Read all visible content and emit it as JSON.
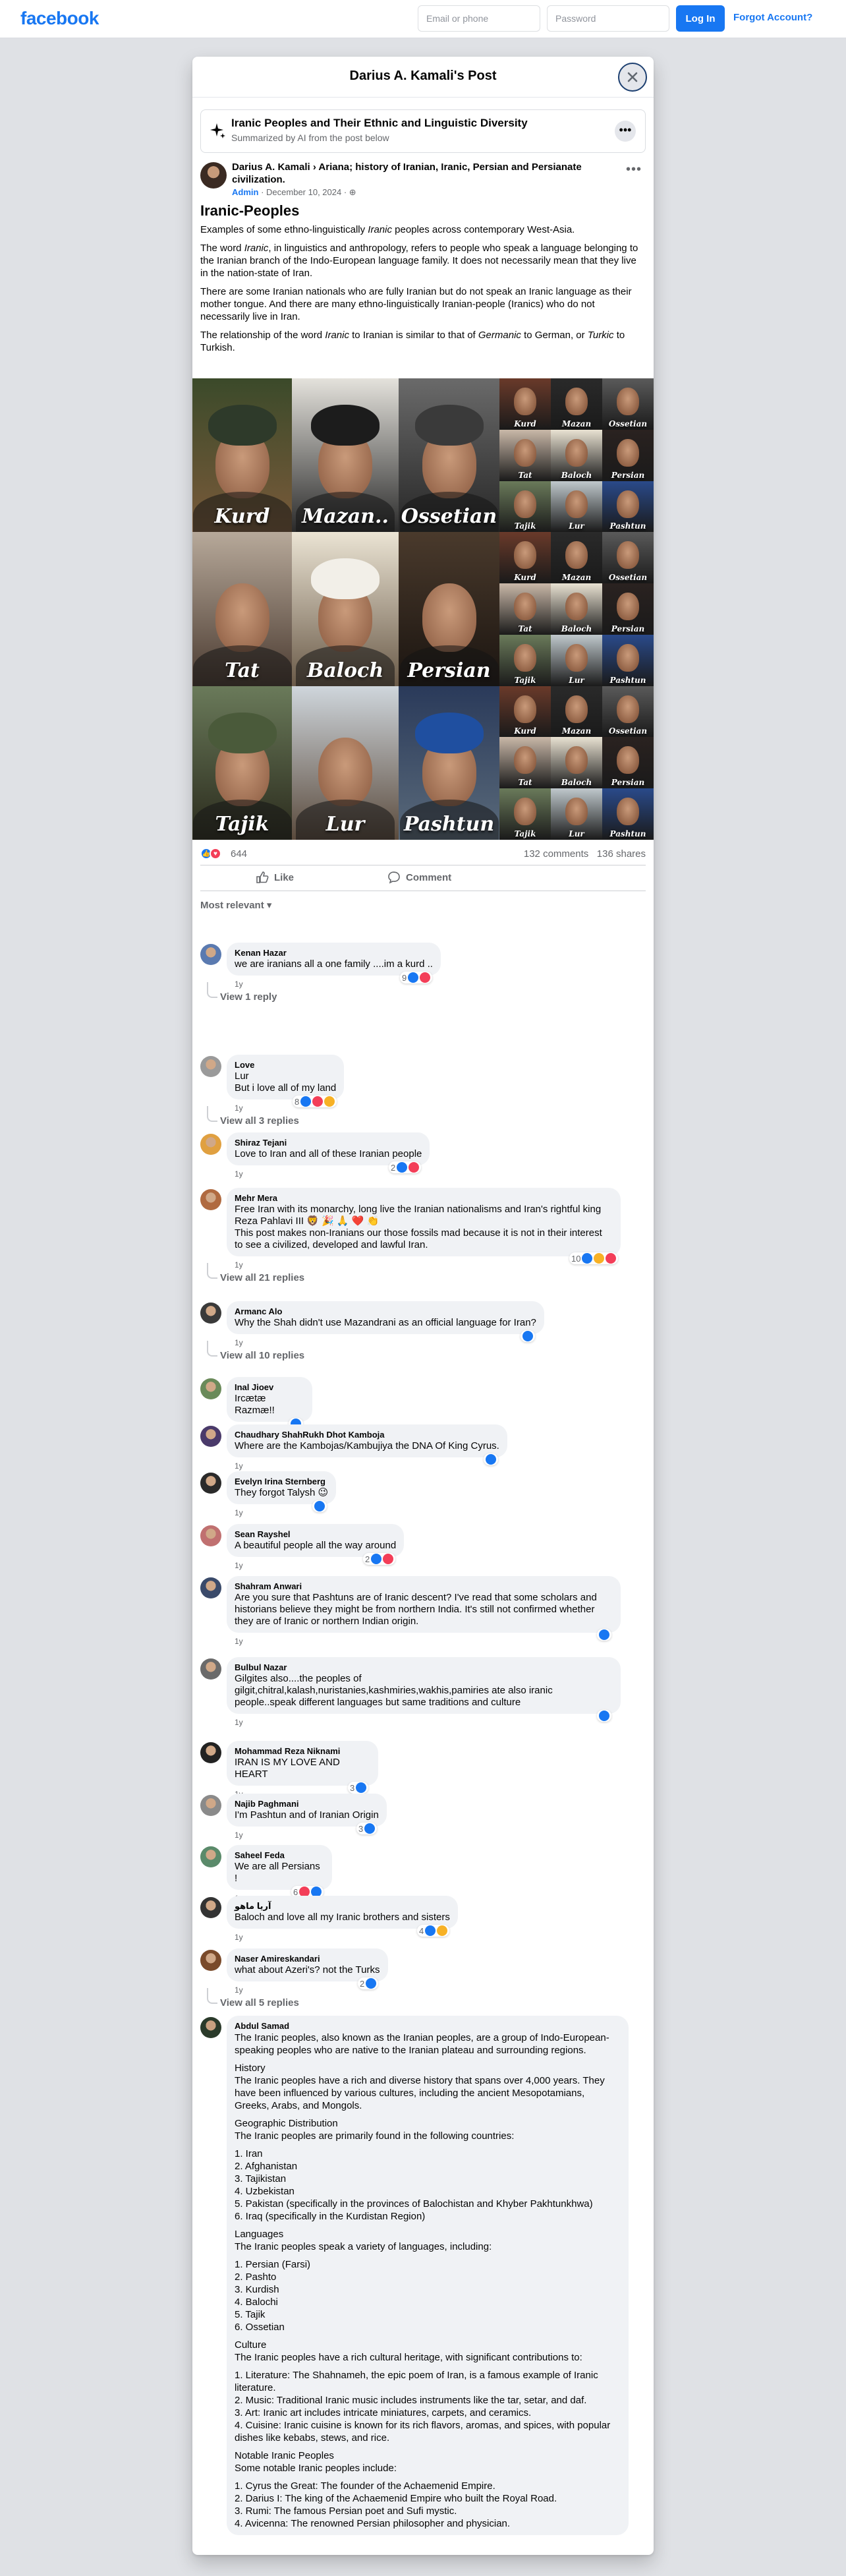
{
  "topbar": {
    "logo": "facebook",
    "email_placeholder": "Email or phone",
    "password_placeholder": "Password",
    "login_label": "Log In",
    "forgot_label": "Forgot Account?"
  },
  "modal": {
    "title": "Darius A. Kamali's Post"
  },
  "summary": {
    "title": "Iranic Peoples and Their Ethnic and Linguistic Diversity",
    "subtitle": "Summarized by AI from the post below"
  },
  "post": {
    "author_line": "Darius A. Kamali › Ariana; history of Iranian, Iranic, Persian and Persianate civilization.",
    "admin_badge": "Admin",
    "date": "December 10, 2024",
    "title": "Iranic-Peoples",
    "p1_a": "Examples of some ethno-linguistically ",
    "p1_em": "Iranic",
    "p1_b": " peoples across contemporary West-Asia.",
    "p2_a": "The word ",
    "p2_em": "Iranic",
    "p2_b": ", in linguistics and anthropology, refers to people who speak a language belonging to the Iranian branch of the Indo-European language family. It does not necessarily mean that they live in the nation-state of Iran.",
    "p3": "There are some Iranian nationals who are fully Iranian but do not speak an Iranic language as their mother tongue. And there are many ethno-linguistically Iranian-people (Iranics) who do not necessarily live in Iran.",
    "p4_a": "The relationship of the word ",
    "p4_em1": "Iranic",
    "p4_b": " to Iranian is similar to that of ",
    "p4_em2": "Germanic",
    "p4_c": " to German, or ",
    "p4_em3": "Turkic",
    "p4_d": " to Turkish."
  },
  "image_labels": {
    "big": [
      "Kurd",
      "Mazan..",
      "Ossetian",
      "Tat",
      "Baloch",
      "Persian",
      "Tajik",
      "Lur",
      "Pashtun"
    ],
    "small": [
      "Kurd",
      "Mazan",
      "Ossetian",
      "Tat",
      "Baloch",
      "Persian",
      "Tajik",
      "Lur",
      "Pashtun"
    ]
  },
  "stats": {
    "reactions": "644",
    "comments": "132 comments",
    "shares": "136 shares"
  },
  "actions": {
    "like": "Like",
    "comment": "Comment"
  },
  "sort_label": "Most relevant",
  "comments": [
    {
      "name": "Kenan Hazar",
      "text": "we are iranians all a one family ....im a kurd ..",
      "time": "1y",
      "count": "9",
      "replies": "View 1 reply"
    },
    {
      "name": "Love",
      "text": "Lur\nBut i love all of my land",
      "time": "1y",
      "count": "8",
      "replies": "View all 3 replies"
    },
    {
      "name": "Shiraz Tejani",
      "text": "Love to Iran and all of these Iranian people",
      "time": "1y",
      "count": "2"
    },
    {
      "name": "Mehr Mera",
      "text": "Free Iran with its monarchy, long live the Iranian nationalisms and Iran's rightful king Reza Pahlavi III 🦁 🎉 🙏 ❤️ 👏\nThis post makes non-Iranians our those fossils mad because it is not in their interest to see a civilized, developed and lawful Iran.",
      "time": "1y",
      "count": "10",
      "replies": "View all 21 replies"
    },
    {
      "name": "Armanc Alo",
      "text": "Why the Shah didn't use Mazandrani as an official language for Iran?",
      "time": "1y",
      "replies": "View all 10 replies"
    },
    {
      "name": "Inal Jioev",
      "text": "Ircætæ Razmæ!!",
      "time": "1y"
    },
    {
      "name": "Chaudhary ShahRukh Dhot Kamboja",
      "text": "Where are the Kambojas/Kambujiya the DNA Of King Cyrus.",
      "time": "1y"
    },
    {
      "name": "Evelyn Irina Sternberg",
      "text": "They forgot Talysh 😉",
      "time": "1y"
    },
    {
      "name": "Sean Rayshel",
      "text": "A beautiful people all the way around",
      "time": "1y",
      "count": "2"
    },
    {
      "name": "Shahram Anwari",
      "text": "Are you sure that Pashtuns are of Iranic descent? I've read that some scholars and historians believe they might be from northern India. It's still not confirmed whether they are of Iranic or northern Indian origin.",
      "time": "1y"
    },
    {
      "name": "Bulbul Nazar",
      "text": "Gilgites also....the peoples of gilgit,chitral,kalash,nuristanies,kashmiries,wakhis,pamiries ate also iranic people..speak different languages but same traditions and culture",
      "time": "1y"
    },
    {
      "name": "Mohammad Reza Niknami",
      "text": "IRAN IS MY LOVE AND HEART",
      "time": "1y",
      "count": "3"
    },
    {
      "name": "Najib Paghmani",
      "text": "I'm Pashtun and of Iranian Origin",
      "time": "1y",
      "count": "3"
    },
    {
      "name": "Saheel Feda",
      "text": "We are all Persians !",
      "time": "1y",
      "count": "6"
    },
    {
      "name": "آریا ماهو",
      "text": "Baloch and love all my Iranic brothers and sisters",
      "time": "1y",
      "count": "4"
    },
    {
      "name": "Naser Amireskandari",
      "text": "what about Azeri's? not the Turks",
      "time": "1y",
      "count": "2",
      "replies": "View all 5 replies"
    }
  ],
  "long_comment": {
    "name": "Abdul Samad",
    "intro": "The Iranic peoples, also known as the Iranian peoples, are a group of Indo-European-speaking peoples who are native to the Iranian plateau and surrounding regions.",
    "h_history": "History",
    "history": "The Iranic peoples have a rich and diverse history that spans over 4,000 years. They have been influenced by various cultures, including the ancient Mesopotamians, Greeks, Arabs, and Mongols.",
    "h_geo": "Geographic Distribution",
    "geo": "The Iranic peoples are primarily found in the following countries:",
    "geo_list": [
      "1. Iran",
      "2. Afghanistan",
      "3. Tajikistan",
      "4. Uzbekistan",
      "5. Pakistan (specifically in the provinces of Balochistan and Khyber Pakhtunkhwa)",
      "6. Iraq (specifically in the Kurdistan Region)"
    ],
    "h_lang": "Languages",
    "lang": "The Iranic peoples speak a variety of languages, including:",
    "lang_list": [
      "1. Persian (Farsi)",
      "2. Pashto",
      "3. Kurdish",
      "4. Balochi",
      "5. Tajik",
      "6. Ossetian"
    ],
    "h_culture": "Culture",
    "culture": "The Iranic peoples have a rich cultural heritage, with significant contributions to:",
    "culture_list": [
      "1. Literature: The Shahnameh, the epic poem of Iran, is a famous example of Iranic literature.",
      "2. Music: Traditional Iranic music includes instruments like the tar, setar, and daf.",
      "3. Art: Iranic art includes intricate miniatures, carpets, and ceramics.",
      "4. Cuisine: Iranic cuisine is known for its rich flavors, aromas, and spices, with popular dishes like kebabs, stews, and rice."
    ],
    "h_notable": "Notable Iranic Peoples",
    "notable": "Some notable Iranic peoples include:",
    "notable_list": [
      "1. Cyrus the Great: The founder of the Achaemenid Empire.",
      "2. Darius I: The king of the Achaemenid Empire who built the Royal Road.",
      "3. Rumi: The famous Persian poet and Sufi mystic.",
      "4. Avicenna: The renowned Persian philosopher and physician."
    ]
  }
}
